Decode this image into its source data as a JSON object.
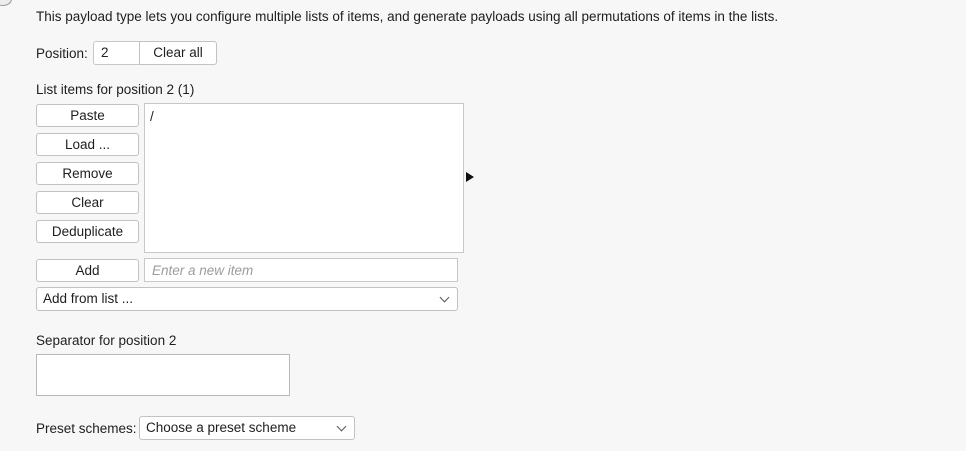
{
  "description": "This payload type lets you configure multiple lists of items, and generate payloads using all permutations of items in the lists.",
  "position": {
    "label": "Position:",
    "value": "2",
    "clear_all_label": "Clear all"
  },
  "list": {
    "title": "List items for position 2 (1)",
    "buttons": {
      "paste": "Paste",
      "load": "Load ...",
      "remove": "Remove",
      "clear": "Clear",
      "deduplicate": "Deduplicate",
      "add": "Add"
    },
    "items": [
      "/"
    ],
    "new_item_placeholder": "Enter a new item",
    "add_from_list": "Add from list ..."
  },
  "separator": {
    "label": "Separator for position 2",
    "value": ""
  },
  "preset": {
    "label": "Preset schemes:",
    "selected": "Choose a preset scheme"
  },
  "icons": {
    "expand_arrow": "triangle-right-icon",
    "dropdown": "chevron-down-icon"
  }
}
